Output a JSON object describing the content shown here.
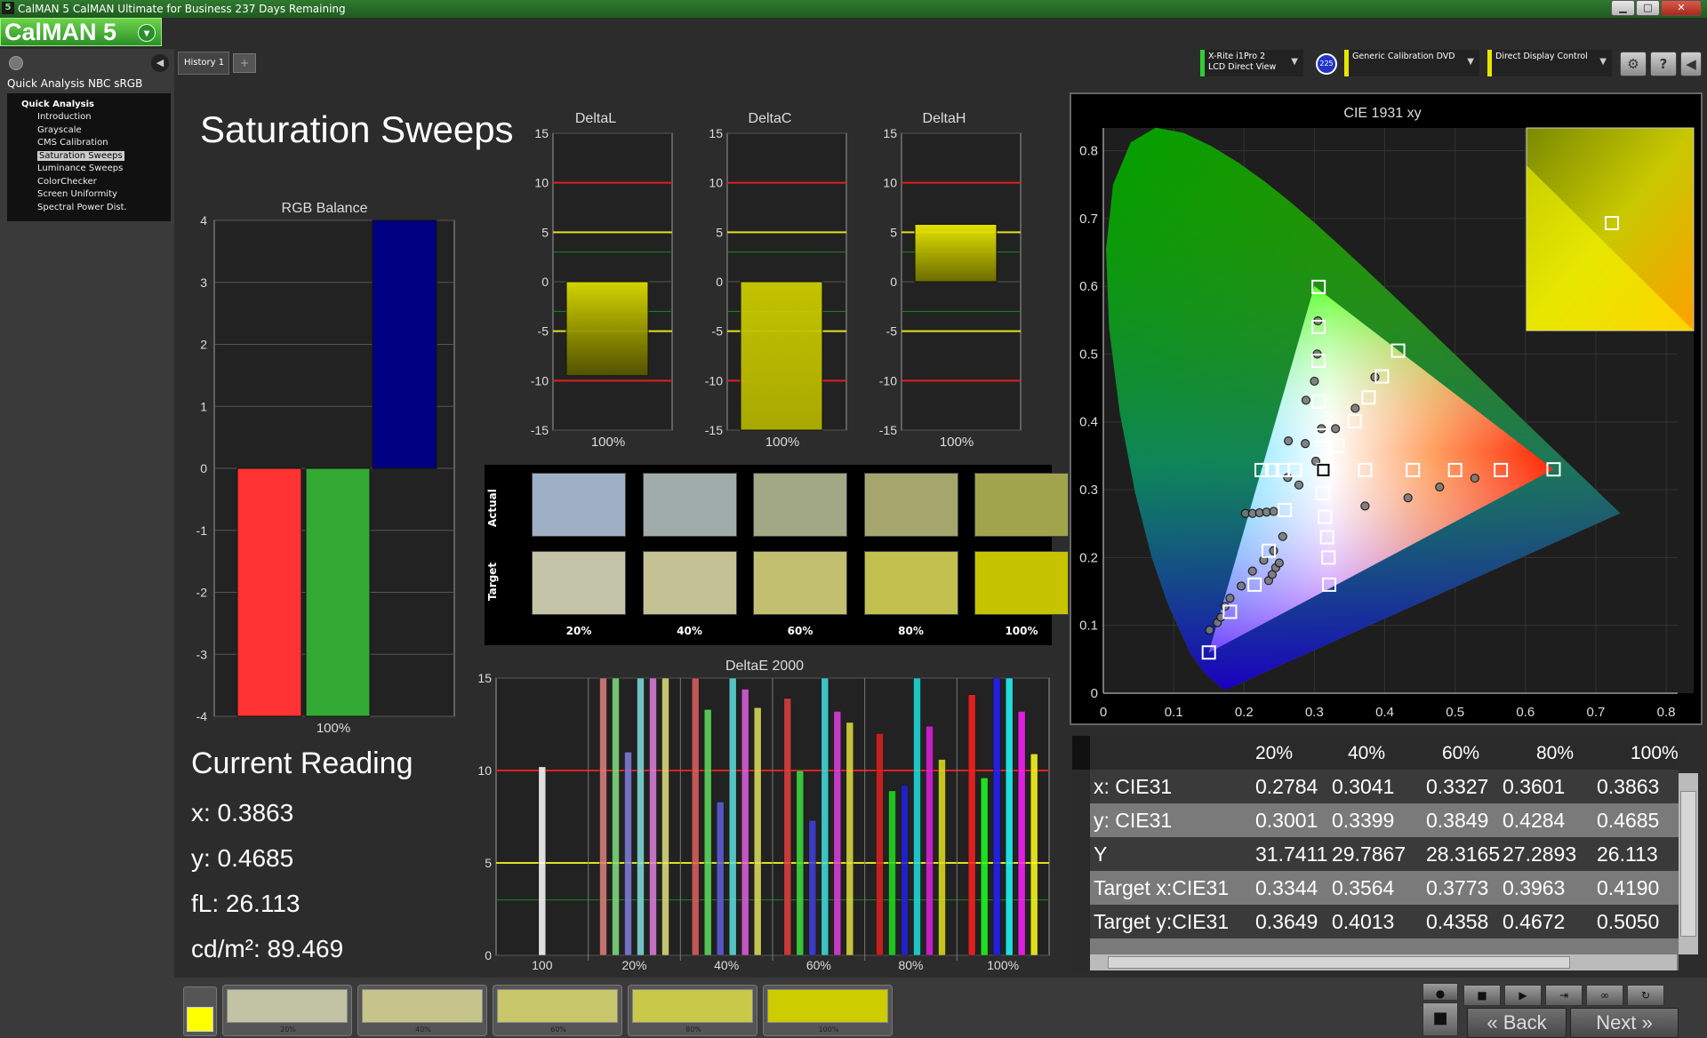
{
  "window": {
    "title": "CalMAN 5 CalMAN Ultimate for Business 237 Days Remaining",
    "app_icon": "5"
  },
  "logo": {
    "text": "CalMAN 5"
  },
  "sidebar": {
    "workflow_title": "Quick Analysis NBC sRGB",
    "root_label": "Quick Analysis",
    "items": [
      {
        "label": "Introduction"
      },
      {
        "label": "Grayscale"
      },
      {
        "label": "CMS Calibration"
      },
      {
        "label": "Saturation Sweeps",
        "selected": true
      },
      {
        "label": "Luminance Sweeps"
      },
      {
        "label": "ColorChecker"
      },
      {
        "label": "Screen Uniformity"
      },
      {
        "label": "Spectral Power Dist."
      }
    ]
  },
  "tabs": [
    {
      "label": "History 1"
    }
  ],
  "devices": {
    "meter": {
      "line1": "X-Rite i1Pro 2",
      "line2": "LCD Direct View",
      "color": "#33cc33"
    },
    "meter_badge": "225",
    "source": {
      "line1": "Generic Calibration DVD",
      "color": "#e6e600"
    },
    "display": {
      "line1": "Direct Display Control",
      "color": "#e6e600"
    }
  },
  "page": {
    "title": "Saturation Sweeps"
  },
  "charts": {
    "rgb_balance": {
      "title": "RGB Balance",
      "ticks": [
        "4",
        "3",
        "2",
        "1",
        "0",
        "-1",
        "-2",
        "-3",
        "-4"
      ],
      "category": "100%"
    },
    "delta_l": {
      "title": "DeltaL",
      "ticks": [
        "15",
        "10",
        "5",
        "0",
        "-5",
        "-10",
        "-15"
      ],
      "category": "100%"
    },
    "delta_c": {
      "title": "DeltaC",
      "ticks": [
        "15",
        "10",
        "5",
        "0",
        "-5",
        "-10",
        "-15"
      ],
      "category": "100%"
    },
    "delta_h": {
      "title": "DeltaH",
      "ticks": [
        "15",
        "10",
        "5",
        "0",
        "-5",
        "-10",
        "-15"
      ],
      "category": "100%"
    },
    "delta_e": {
      "title": "DeltaE 2000",
      "ticks": [
        "15",
        "10",
        "5",
        "0"
      ],
      "categories": [
        "100",
        "20%",
        "40%",
        "60%",
        "80%",
        "100%"
      ]
    },
    "cie": {
      "title": "CIE 1931 xy",
      "xticks": [
        "0",
        "0.1",
        "0.2",
        "0.3",
        "0.4",
        "0.5",
        "0.6",
        "0.7",
        "0.8"
      ],
      "yticks": [
        "0",
        "0.1",
        "0.2",
        "0.3",
        "0.4",
        "0.5",
        "0.6",
        "0.7",
        "0.8"
      ]
    }
  },
  "chart_data": [
    {
      "type": "bar",
      "title": "RGB Balance",
      "categories": [
        "100%"
      ],
      "series": [
        {
          "values": [
            -4
          ],
          "color": "#ff3333"
        },
        {
          "values": [
            -4
          ],
          "color": "#33aa33"
        },
        {
          "values": [
            4
          ],
          "color": "#000080"
        }
      ],
      "ylim": [
        -4,
        4
      ]
    },
    {
      "type": "bar",
      "title": "DeltaL",
      "categories": [
        "100%"
      ],
      "values": [
        -9.5
      ],
      "ylim": [
        -15,
        15
      ]
    },
    {
      "type": "bar",
      "title": "DeltaC",
      "categories": [
        "100%"
      ],
      "values": [
        -15
      ],
      "ylim": [
        -15,
        15
      ]
    },
    {
      "type": "bar",
      "title": "DeltaH",
      "categories": [
        "100%"
      ],
      "values": [
        5.8
      ],
      "ylim": [
        -15,
        15
      ]
    },
    {
      "type": "bar",
      "title": "DeltaE 2000",
      "ylim": [
        0,
        15
      ],
      "groups": [
        {
          "label": "100",
          "bars": [
            {
              "value": 10.2,
              "color": "#ffffff"
            }
          ]
        },
        {
          "label": "20%",
          "bars": [
            {
              "value": 15,
              "color": "#e08080"
            },
            {
              "value": 15,
              "color": "#80e080"
            },
            {
              "value": 11,
              "color": "#8080e0"
            },
            {
              "value": 15,
              "color": "#80e0e0"
            },
            {
              "value": 15,
              "color": "#e080e0"
            },
            {
              "value": 15,
              "color": "#e0e080"
            }
          ]
        },
        {
          "label": "40%",
          "bars": [
            {
              "value": 15,
              "color": "#e06060"
            },
            {
              "value": 13.3,
              "color": "#60e060"
            },
            {
              "value": 8.3,
              "color": "#6060e0"
            },
            {
              "value": 15,
              "color": "#60e0e0"
            },
            {
              "value": 14.4,
              "color": "#e060e0"
            },
            {
              "value": 13.4,
              "color": "#e0e060"
            }
          ]
        },
        {
          "label": "60%",
          "bars": [
            {
              "value": 13.9,
              "color": "#e04040"
            },
            {
              "value": 10,
              "color": "#40e040"
            },
            {
              "value": 7.3,
              "color": "#4040e0"
            },
            {
              "value": 15,
              "color": "#40e0e0"
            },
            {
              "value": 13.2,
              "color": "#e040e0"
            },
            {
              "value": 12.6,
              "color": "#e0e040"
            }
          ]
        },
        {
          "label": "80%",
          "bars": [
            {
              "value": 12,
              "color": "#e02020"
            },
            {
              "value": 8.9,
              "color": "#20e020"
            },
            {
              "value": 9.2,
              "color": "#2020e0"
            },
            {
              "value": 15,
              "color": "#20e0e0"
            },
            {
              "value": 12.4,
              "color": "#e020e0"
            },
            {
              "value": 10.6,
              "color": "#e0e020"
            }
          ]
        },
        {
          "label": "100%",
          "bars": [
            {
              "value": 14.1,
              "color": "#ff2020"
            },
            {
              "value": 9.6,
              "color": "#20ff20"
            },
            {
              "value": 15,
              "color": "#2020ff"
            },
            {
              "value": 15,
              "color": "#20ffff"
            },
            {
              "value": 13.2,
              "color": "#ff20ff"
            },
            {
              "value": 10.9,
              "color": "#ffff20"
            }
          ]
        }
      ]
    },
    {
      "type": "scatter",
      "title": "CIE 1931 xy",
      "xlim": [
        0,
        0.8
      ],
      "ylim": [
        0,
        0.8
      ],
      "targets": [
        [
          0.15,
          0.06
        ],
        [
          0.18,
          0.12
        ],
        [
          0.215,
          0.16
        ],
        [
          0.235,
          0.21
        ],
        [
          0.258,
          0.27
        ],
        [
          0.272,
          0.329
        ],
        [
          0.306,
          0.599
        ],
        [
          0.306,
          0.54
        ],
        [
          0.306,
          0.49
        ],
        [
          0.306,
          0.43
        ],
        [
          0.312,
          0.38
        ],
        [
          0.333,
          0.365
        ],
        [
          0.357,
          0.401
        ],
        [
          0.377,
          0.436
        ],
        [
          0.396,
          0.467
        ],
        [
          0.419,
          0.505
        ],
        [
          0.313,
          0.329
        ],
        [
          0.312,
          0.295
        ],
        [
          0.315,
          0.26
        ],
        [
          0.318,
          0.23
        ],
        [
          0.32,
          0.2
        ],
        [
          0.321,
          0.16
        ],
        [
          0.225,
          0.329
        ],
        [
          0.24,
          0.329
        ],
        [
          0.255,
          0.329
        ],
        [
          0.273,
          0.329
        ],
        [
          0.372,
          0.329
        ],
        [
          0.44,
          0.329
        ],
        [
          0.5,
          0.329
        ],
        [
          0.565,
          0.329
        ],
        [
          0.64,
          0.33
        ]
      ],
      "measured": [
        [
          0.151,
          0.093
        ],
        [
          0.162,
          0.104
        ],
        [
          0.167,
          0.112
        ],
        [
          0.173,
          0.128
        ],
        [
          0.18,
          0.14
        ],
        [
          0.196,
          0.158
        ],
        [
          0.212,
          0.18
        ],
        [
          0.228,
          0.196
        ],
        [
          0.242,
          0.21
        ],
        [
          0.255,
          0.231
        ],
        [
          0.235,
          0.166
        ],
        [
          0.24,
          0.175
        ],
        [
          0.245,
          0.185
        ],
        [
          0.25,
          0.192
        ],
        [
          0.202,
          0.265
        ],
        [
          0.212,
          0.265
        ],
        [
          0.222,
          0.266
        ],
        [
          0.232,
          0.267
        ],
        [
          0.242,
          0.268
        ],
        [
          0.262,
          0.318
        ],
        [
          0.278,
          0.307
        ],
        [
          0.287,
          0.368
        ],
        [
          0.302,
          0.342
        ],
        [
          0.31,
          0.39
        ],
        [
          0.33,
          0.39
        ],
        [
          0.358,
          0.42
        ],
        [
          0.386,
          0.466
        ],
        [
          0.305,
          0.549
        ],
        [
          0.304,
          0.5
        ],
        [
          0.3,
          0.46
        ],
        [
          0.288,
          0.432
        ],
        [
          0.263,
          0.372
        ],
        [
          0.372,
          0.276
        ],
        [
          0.433,
          0.288
        ],
        [
          0.478,
          0.304
        ],
        [
          0.528,
          0.317
        ]
      ],
      "white": [
        0.3127,
        0.329
      ]
    }
  ],
  "swatches": {
    "actual_label": "Actual",
    "target_label": "Target",
    "items": [
      {
        "label": "20%",
        "actual": "#9eb0c4",
        "target": "#c4c4a8"
      },
      {
        "label": "40%",
        "actual": "#a0acaa",
        "target": "#c4c294"
      },
      {
        "label": "60%",
        "actual": "#a2a886",
        "target": "#c2c070"
      },
      {
        "label": "80%",
        "actual": "#a4a66e",
        "target": "#c2c04e"
      },
      {
        "label": "100%",
        "actual": "#a2a44c",
        "target": "#c6c400"
      }
    ]
  },
  "current_reading": {
    "title": "Current Reading",
    "x": "x: 0.3863",
    "y": "y: 0.4685",
    "fl": "fL: 26.113",
    "cdm2": "cd/m²: 89.469"
  },
  "table": {
    "columns": [
      "20%",
      "40%",
      "60%",
      "80%",
      "100%"
    ],
    "rows": [
      {
        "label": "x: CIE31",
        "values": [
          "0.2784",
          "0.3041",
          "0.3327",
          "0.3601",
          "0.3863"
        ]
      },
      {
        "label": "y: CIE31",
        "values": [
          "0.3001",
          "0.3399",
          "0.3849",
          "0.4284",
          "0.4685"
        ]
      },
      {
        "label": "Y",
        "values": [
          "31.7411",
          "29.7867",
          "28.3165",
          "27.2893",
          "26.113"
        ]
      },
      {
        "label": "Target x:CIE31",
        "values": [
          "0.3344",
          "0.3564",
          "0.3773",
          "0.3963",
          "0.4190"
        ]
      },
      {
        "label": "Target y:CIE31",
        "values": [
          "0.3649",
          "0.4013",
          "0.4358",
          "0.4672",
          "0.5050"
        ]
      }
    ]
  },
  "bottom": {
    "current_color": "#ffff00",
    "patches": [
      {
        "label": "20%",
        "color": "#c2c2a4"
      },
      {
        "label": "40%",
        "color": "#c6c48a"
      },
      {
        "label": "60%",
        "color": "#c8c66a"
      },
      {
        "label": "80%",
        "color": "#cac848"
      },
      {
        "label": "100%",
        "color": "#cccc00"
      }
    ],
    "back_label": "Back",
    "next_label": "Next"
  }
}
